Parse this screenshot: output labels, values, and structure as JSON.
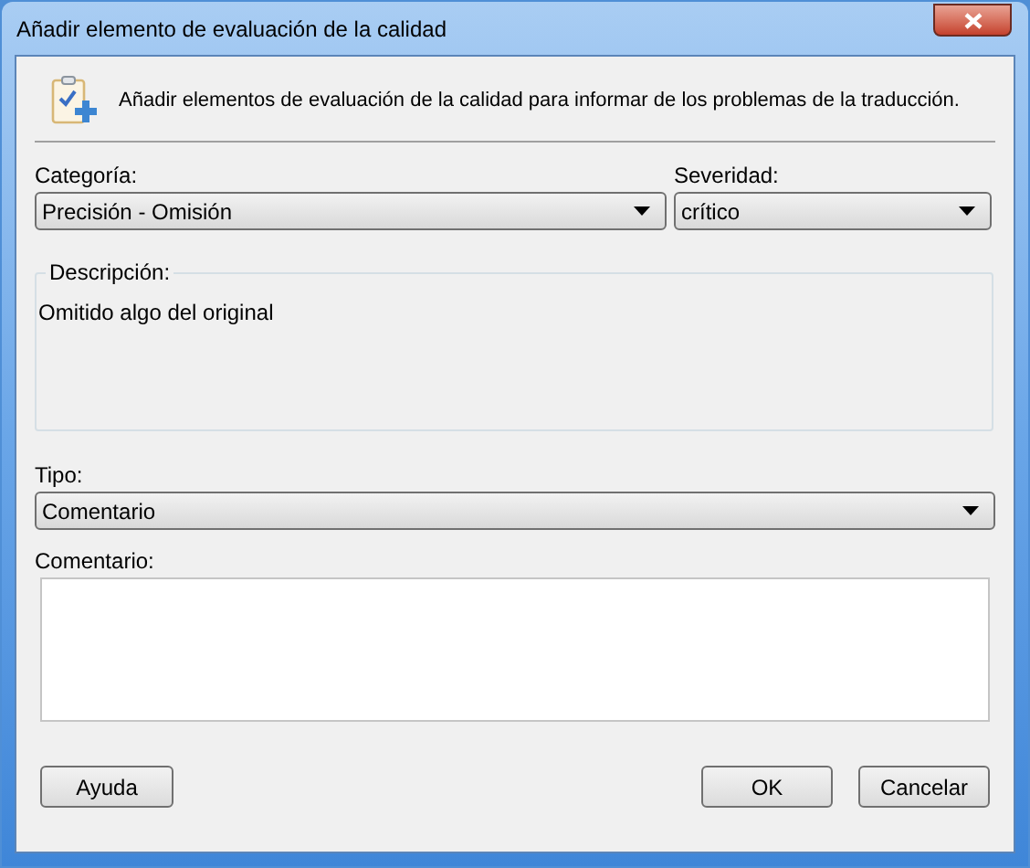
{
  "window": {
    "title": "Añadir elemento de evaluación de la calidad"
  },
  "header": {
    "text": "Añadir elementos de evaluación de la calidad para informar de los problemas de la traducción."
  },
  "category": {
    "label": "Categoría:",
    "value": "Precisión - Omisión"
  },
  "severity": {
    "label": "Severidad:",
    "value": "crítico"
  },
  "description": {
    "legend": "Descripción:",
    "text": "Omitido algo del original"
  },
  "type": {
    "label": "Tipo:",
    "value": "Comentario"
  },
  "comment": {
    "label": "Comentario:"
  },
  "buttons": [
    {
      "label": "Ayuda",
      "kind": "left"
    },
    {
      "label": "OK",
      "kind": "right"
    },
    {
      "label": "Cancelar",
      "kind": "right"
    }
  ]
}
